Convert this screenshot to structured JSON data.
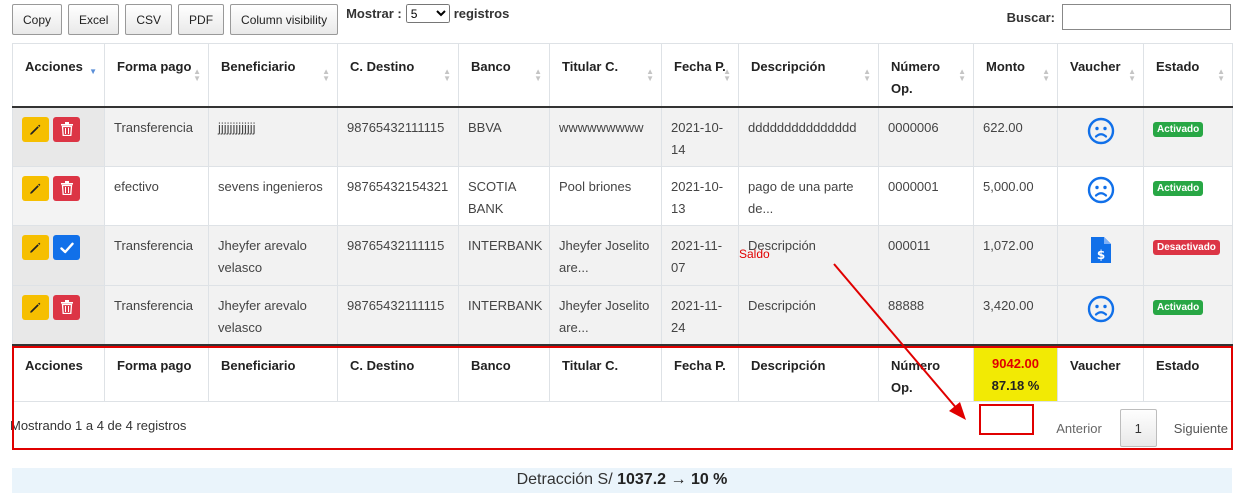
{
  "toolbar": {
    "copy": "Copy",
    "excel": "Excel",
    "csv": "CSV",
    "pdf": "PDF",
    "column_visibility": "Column visibility",
    "show_label": "Mostrar :",
    "show_value": "5",
    "show_suffix": "registros",
    "search_label": "Buscar:",
    "search_value": ""
  },
  "table": {
    "columns": [
      "Acciones",
      "Forma pago",
      "Beneficiario",
      "C. Destino",
      "Banco",
      "Titular C.",
      "Fecha P.",
      "Descripción",
      "Número Op.",
      "Monto",
      "Vaucher",
      "Estado"
    ],
    "rows": [
      {
        "forma": "Transferencia",
        "beneficiario": "jjjjjjjjjjjjj",
        "destino": "98765432111115",
        "banco": "BBVA",
        "titular": "wwwwwwwww",
        "fecha": "2021-10-14",
        "descripcion": "ddddddddddddddd",
        "numero": "0000006",
        "monto": "622.00",
        "estado": "Activado"
      },
      {
        "forma": "efectivo",
        "beneficiario": "sevens ingenieros",
        "destino": "98765432154321",
        "banco": "SCOTIA BANK",
        "titular": "Pool briones",
        "fecha": "2021-10-13",
        "descripcion": "pago de una parte de...",
        "numero": "0000001",
        "monto": "5,000.00",
        "estado": "Activado"
      },
      {
        "forma": "Transferencia",
        "beneficiario": "Jheyfer arevalo velasco",
        "destino": "98765432111115",
        "banco": "INTERBANK",
        "titular": "Jheyfer Joselito are...",
        "fecha": "2021-11-07",
        "descripcion": "Descripción",
        "numero": "000011",
        "monto": "1,072.00",
        "estado": "Desactivado"
      },
      {
        "forma": "Transferencia",
        "beneficiario": "Jheyfer arevalo velasco",
        "destino": "98765432111115",
        "banco": "INTERBANK",
        "titular": "Jheyfer Joselito are...",
        "fecha": "2021-11-24",
        "descripcion": "Descripción",
        "numero": "88888",
        "monto": "3,420.00",
        "estado": "Activado"
      }
    ],
    "footer": {
      "total_amount": "9042.00",
      "total_percent": "87.18 %"
    }
  },
  "annotation": {
    "saldo": "Saldo"
  },
  "info": "Mostrando 1 a 4 de 4 registros",
  "pagination": {
    "prev": "Anterior",
    "page": "1",
    "next": "Siguiente"
  },
  "detraccion": {
    "prefix": "Detracción S/",
    "amount": "1037.2",
    "arrow": "→",
    "percent": "10 %"
  },
  "colors": {
    "accent_blue": "#1170e9",
    "edit_yellow": "#f6bf00",
    "delete_red": "#dc3545",
    "badge_green": "#28a745",
    "annotation_red": "#e00000",
    "total_highlight": "#f2ea04"
  }
}
